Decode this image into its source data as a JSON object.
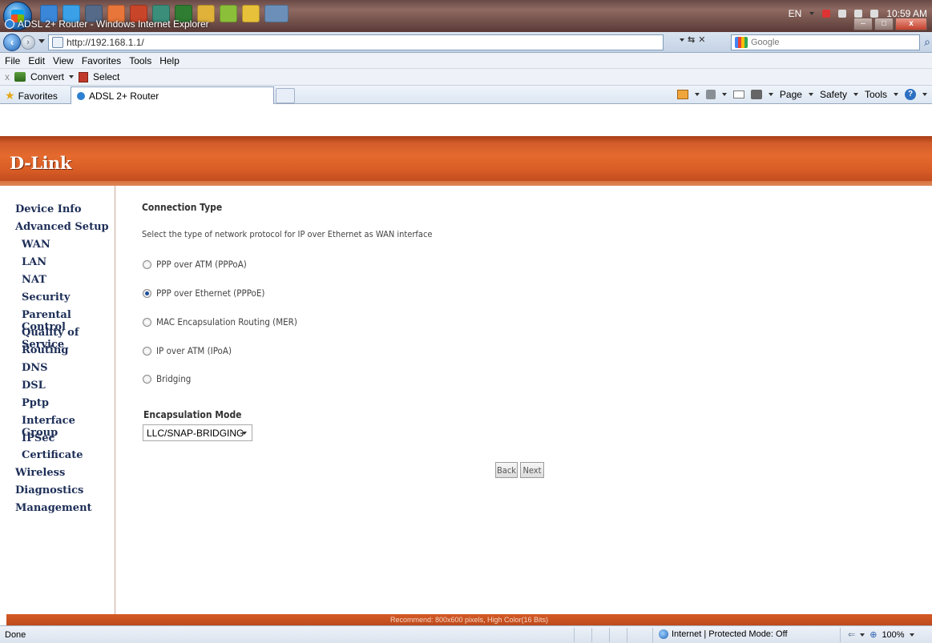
{
  "taskbar": {
    "language": "EN",
    "clock": "10:59 AM"
  },
  "window": {
    "title": "ADSL 2+ Router - Windows Internet Explorer"
  },
  "address_bar": {
    "url": "http://192.168.1.1/",
    "search_placeholder": "Google"
  },
  "menu": {
    "items": [
      "File",
      "Edit",
      "View",
      "Favorites",
      "Tools",
      "Help"
    ]
  },
  "toolbar": {
    "close": "x",
    "convert_label": "Convert",
    "select_label": "Select"
  },
  "favorites_bar": {
    "favorites_label": "Favorites",
    "tab_title": "ADSL 2+ Router",
    "page_label": "Page",
    "safety_label": "Safety",
    "tools_label": "Tools"
  },
  "brand": {
    "logo": "D-Link",
    "accent_color": "#d75b25"
  },
  "sidebar": {
    "items": [
      {
        "label": "Device Info",
        "level": 0
      },
      {
        "label": "Advanced Setup",
        "level": 0
      },
      {
        "label": "WAN",
        "level": 1
      },
      {
        "label": "LAN",
        "level": 1
      },
      {
        "label": "NAT",
        "level": 1
      },
      {
        "label": "Security",
        "level": 1
      },
      {
        "label": "Parental Control",
        "level": 1
      },
      {
        "label": "Quality of Service",
        "level": 1
      },
      {
        "label": "Routing",
        "level": 1
      },
      {
        "label": "DNS",
        "level": 1
      },
      {
        "label": "DSL",
        "level": 1
      },
      {
        "label": "Pptp",
        "level": 1
      },
      {
        "label": "Interface Group",
        "level": 1
      },
      {
        "label": "IPSec",
        "level": 1
      },
      {
        "label": "Certificate",
        "level": 1
      },
      {
        "label": "Wireless",
        "level": 0
      },
      {
        "label": "Diagnostics",
        "level": 0
      },
      {
        "label": "Management",
        "level": 0
      }
    ]
  },
  "main": {
    "heading": "Connection Type",
    "description": "Select the type of network protocol for IP over Ethernet as WAN interface",
    "options": [
      {
        "label": "PPP over ATM (PPPoA)",
        "selected": false
      },
      {
        "label": "PPP over Ethernet (PPPoE)",
        "selected": true
      },
      {
        "label": "MAC Encapsulation Routing (MER)",
        "selected": false
      },
      {
        "label": "IP over ATM (IPoA)",
        "selected": false
      },
      {
        "label": "Bridging",
        "selected": false
      }
    ],
    "encapsulation_label": "Encapsulation Mode",
    "encapsulation_value": "LLC/SNAP-BRIDGING",
    "back_label": "Back",
    "next_label": "Next"
  },
  "footer": {
    "text": "Recommend: 800x600 pixels, High Color(16 Bits)"
  },
  "statusbar": {
    "done": "Done",
    "zone": "Internet | Protected Mode: Off",
    "zoom": "100%"
  }
}
